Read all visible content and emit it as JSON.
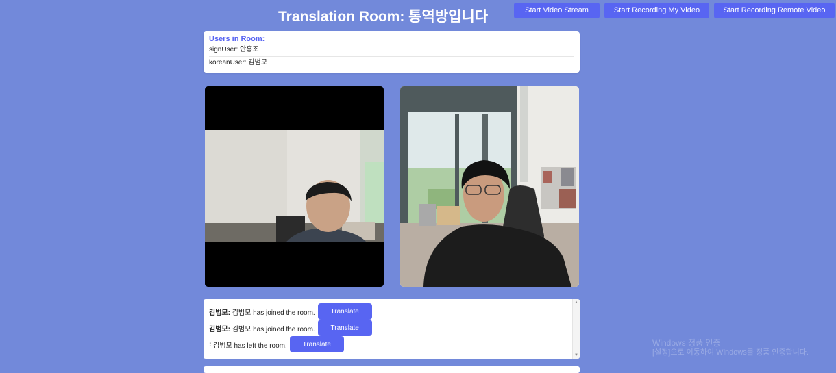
{
  "header": {
    "title": "Translation Room: 통역방입니다",
    "buttons": {
      "start_stream": "Start Video Stream",
      "start_recording_my": "Start Recording My Video",
      "start_recording_remote": "Start Recording Remote Video"
    }
  },
  "users": {
    "title": "Users in Room:",
    "list": [
      "signUser: 안홍조",
      "koreanUser: 김범모"
    ]
  },
  "chat": {
    "messages": [
      {
        "sender": "김범모:",
        "text": "김범모 has joined the room.",
        "button": "Translate"
      },
      {
        "sender": "김범모:",
        "text": "김범모 has joined the room.",
        "button": "Translate"
      },
      {
        "sender": ":",
        "text": "김범모 has left the room.",
        "button": "Translate"
      }
    ]
  },
  "watermark": {
    "line1": "Windows 정품 인증",
    "line2": "[설정]으로 이동하여 Windows를 정품 인증합니다."
  },
  "colors": {
    "background": "#7289da",
    "accent": "#5865f2"
  }
}
